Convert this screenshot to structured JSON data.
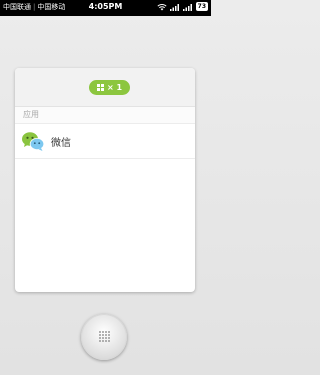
{
  "status_bar": {
    "carrier_1": "中国联通",
    "carrier_2": "中国移动",
    "time": "4:05PM",
    "battery": "73"
  },
  "recents": {
    "count_label": "× 1",
    "section_label": "应用",
    "apps": [
      {
        "name": "微信",
        "icon": "wechat-icon"
      }
    ]
  }
}
